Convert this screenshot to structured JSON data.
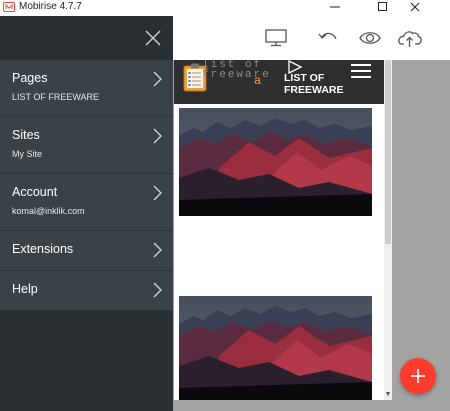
{
  "window": {
    "title": "Mobirise 4.7.7",
    "controls": [
      "minimize-icon",
      "maximize-icon",
      "close-icon"
    ]
  },
  "toolbar": {
    "icons": [
      "desktop-preview-icon",
      "undo-icon",
      "preview-eye-icon",
      "publish-cloud-icon"
    ]
  },
  "sidebar": {
    "close_icon": "close-icon",
    "items": [
      {
        "label": "Pages",
        "sub": "LIST OF FREEWARE"
      },
      {
        "label": "Sites",
        "sub": "My Site"
      },
      {
        "label": "Account",
        "sub": "komal@inklik.com"
      },
      {
        "label": "Extensions",
        "sub": ""
      },
      {
        "label": "Help",
        "sub": ""
      }
    ]
  },
  "site": {
    "logo_text": "list of freeware",
    "logo_accent": "a",
    "title_line1": "LIST OF",
    "title_line2": "FREEWARE"
  },
  "fab": {
    "icon": "plus-icon"
  },
  "colors": {
    "sidebar": "#2a2f33",
    "menu": "#3a4247",
    "accent": "#ff3d2f",
    "site_header": "#2f2f2f"
  }
}
